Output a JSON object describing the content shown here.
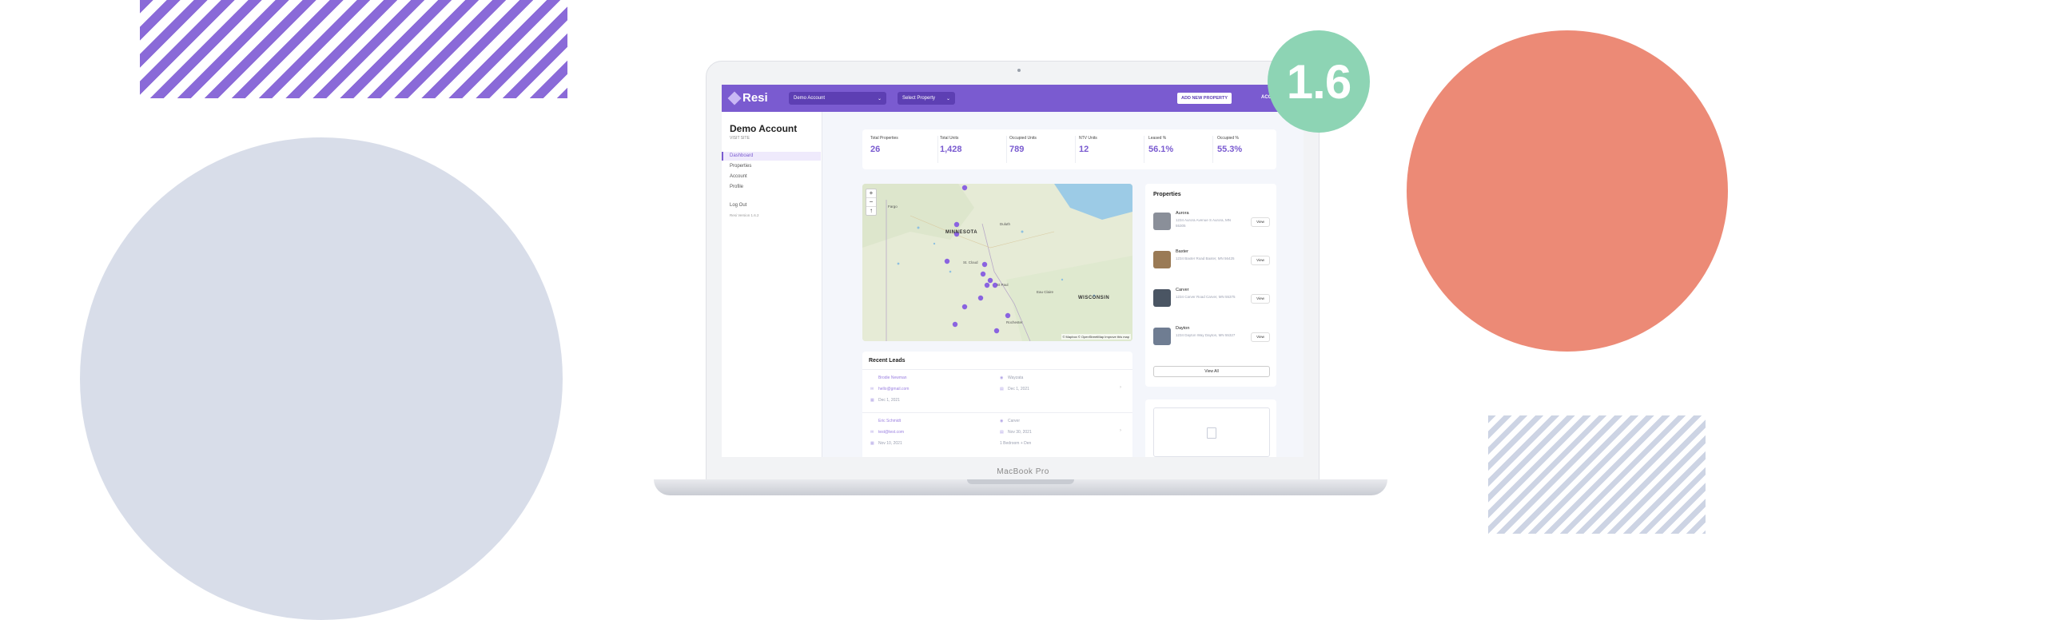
{
  "badge": {
    "version": "1.6"
  },
  "device": {
    "label": "MacBook Pro"
  },
  "app": {
    "logo_text": "Resi",
    "account_select": "Demo Account",
    "property_select": "Select Property",
    "add_property_button": "ADD NEW PROPERTY",
    "account_link": "ACC"
  },
  "sidebar": {
    "title": "Demo Account",
    "subtitle": "VISIT SITE",
    "items": [
      {
        "label": "Dashboard"
      },
      {
        "label": "Properties"
      },
      {
        "label": "Account"
      },
      {
        "label": "Profile"
      }
    ],
    "logout": "Log Out",
    "version": "Resi Version 1.6.2"
  },
  "stats": [
    {
      "label": "Total Properties",
      "value": "26"
    },
    {
      "label": "Total Units",
      "value": "1,428"
    },
    {
      "label": "Occupied Units",
      "value": "789"
    },
    {
      "label": "NTV Units",
      "value": "12"
    },
    {
      "label": "Leased %",
      "value": "56.1%"
    },
    {
      "label": "Occupied %",
      "value": "55.3%"
    }
  ],
  "map": {
    "zoom_in": "+",
    "zoom_out": "−",
    "reset": "↑",
    "labels": {
      "minnesota": "MINNESOTA",
      "wisconsin": "WISCONSIN"
    },
    "cities": {
      "fargo": "Fargo",
      "duluth": "Duluth",
      "st_cloud": "St. Cloud",
      "eau_claire": "Eau Claire",
      "rochester": "Rochester",
      "st_paul": "St Paul"
    },
    "attribution": "© Mapbox © OpenStreetMap  Improve this map"
  },
  "properties": {
    "title": "Properties",
    "items": [
      {
        "name": "Aurora",
        "address": "1234 Aurora Avenue S Aurora, MN 55305",
        "view": "View",
        "color": "#8a8f99"
      },
      {
        "name": "Baxter",
        "address": "1234 Baxter Road Baxter, MN 56425",
        "view": "View",
        "color": "#9a7a55"
      },
      {
        "name": "Carver",
        "address": "1234 Carver Road Carver, MN 55375",
        "view": "View",
        "color": "#4a5563"
      },
      {
        "name": "Dayton",
        "address": "1234 Dayton Way Dayton, MN 55327",
        "view": "View",
        "color": "#6f7d92"
      }
    ],
    "view_all": "View All"
  },
  "leads": {
    "title": "Recent Leads",
    "items": [
      {
        "name": "Brodie Newman",
        "email": "hello@gmail.com",
        "date": "Dec 1, 2021",
        "property": "Wayzata",
        "move_in": "Dec 1, 2021"
      },
      {
        "name": "Eric Schmidt",
        "email": "test@test.com",
        "date": "Nov 10, 2021",
        "property": "Carver",
        "move_in": "Nov 30, 2021",
        "unit": "1 Bedroom + Den"
      }
    ]
  }
}
